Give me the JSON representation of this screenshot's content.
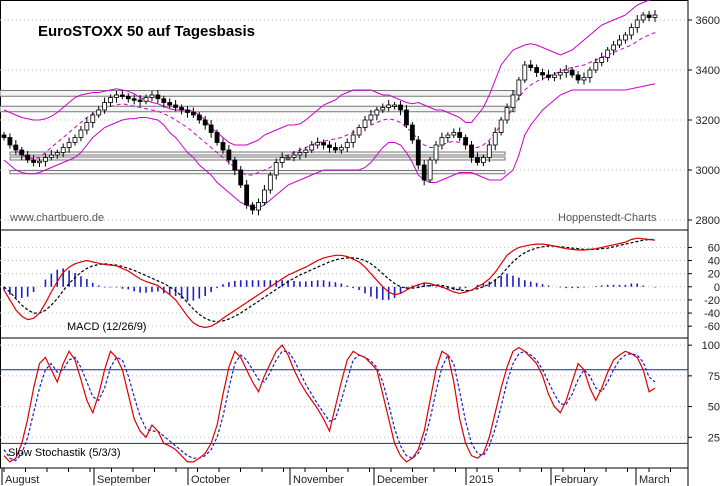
{
  "chart_data": [
    {
      "type": "candlestick",
      "title": "EuroSTOXX 50 auf Tagesbasis",
      "watermark_left": "www.chartbuero.de",
      "watermark_right": "Hoppenstedt-Charts",
      "y_ticks": [
        "2800",
        "3000",
        "3200",
        "3400",
        "3600"
      ],
      "ylim": [
        2760,
        3680
      ],
      "x_months": [
        "August",
        "September",
        "October",
        "November",
        "December",
        "2015",
        "February",
        "March"
      ],
      "resistance_boxes": [
        [
          3295,
          3318
        ],
        [
          3233,
          3255
        ],
        [
          3060,
          3072
        ],
        [
          3040,
          3052
        ],
        [
          2985,
          2998
        ]
      ],
      "series": [
        {
          "role": "price",
          "values": [
            3130,
            3100,
            3080,
            3060,
            3040,
            3030,
            3035,
            3050,
            3060,
            3070,
            3090,
            3110,
            3130,
            3160,
            3190,
            3220,
            3240,
            3270,
            3290,
            3300,
            3295,
            3285,
            3280,
            3275,
            3290,
            3300,
            3285,
            3270,
            3260,
            3250,
            3240,
            3230,
            3220,
            3200,
            3180,
            3150,
            3110,
            3080,
            3040,
            3000,
            2940,
            2860,
            2840,
            2870,
            2920,
            2980,
            3030,
            3050,
            3050,
            3060,
            3070,
            3080,
            3100,
            3110,
            3100,
            3090,
            3080,
            3090,
            3110,
            3140,
            3170,
            3200,
            3220,
            3240,
            3250,
            3260,
            3260,
            3240,
            3180,
            3120,
            3020,
            2960,
            3040,
            3100,
            3130,
            3140,
            3150,
            3130,
            3100,
            3050,
            3030,
            3050,
            3100,
            3150,
            3200,
            3250,
            3300,
            3360,
            3420,
            3410,
            3390,
            3380,
            3370,
            3380,
            3390,
            3400,
            3380,
            3360,
            3370,
            3400,
            3430,
            3450,
            3480,
            3500,
            3520,
            3540,
            3570,
            3600,
            3620,
            3610,
            3620
          ]
        },
        {
          "role": "bollinger-mid",
          "values": [
            3140,
            3110,
            3080,
            3060,
            3050,
            3045,
            3050,
            3070,
            3090,
            3110,
            3130,
            3150,
            3170,
            3190,
            3210,
            3225,
            3235,
            3245,
            3255,
            3260,
            3265,
            3260,
            3255,
            3250,
            3245,
            3240,
            3235,
            3225,
            3215,
            3200,
            3185,
            3170,
            3150,
            3130,
            3110,
            3090,
            3070,
            3050,
            3030,
            3010,
            2990,
            2980,
            2980,
            2990,
            3000,
            3010,
            3030,
            3050,
            3060,
            3070,
            3080,
            3090,
            3100,
            3110,
            3115,
            3120,
            3125,
            3130,
            3140,
            3150,
            3160,
            3170,
            3180,
            3190,
            3200,
            3205,
            3200,
            3190,
            3170,
            3150,
            3120,
            3100,
            3090,
            3090,
            3100,
            3110,
            3115,
            3110,
            3100,
            3090,
            3090,
            3100,
            3120,
            3150,
            3180,
            3210,
            3250,
            3290,
            3320,
            3340,
            3355,
            3365,
            3375,
            3385,
            3395,
            3405,
            3410,
            3415,
            3420,
            3430,
            3440,
            3450,
            3460,
            3470,
            3480,
            3490,
            3500,
            3515,
            3530,
            3540,
            3550
          ]
        },
        {
          "role": "bollinger-upper",
          "values": [
            3240,
            3230,
            3220,
            3210,
            3205,
            3200,
            3200,
            3205,
            3215,
            3230,
            3250,
            3270,
            3290,
            3300,
            3305,
            3310,
            3310,
            3315,
            3320,
            3325,
            3320,
            3315,
            3305,
            3290,
            3280,
            3270,
            3265,
            3255,
            3245,
            3240,
            3240,
            3240,
            3235,
            3220,
            3200,
            3170,
            3150,
            3130,
            3110,
            3100,
            3100,
            3100,
            3110,
            3120,
            3140,
            3150,
            3160,
            3170,
            3180,
            3180,
            3185,
            3200,
            3220,
            3240,
            3260,
            3270,
            3280,
            3300,
            3310,
            3320,
            3320,
            3320,
            3320,
            3310,
            3300,
            3300,
            3290,
            3280,
            3270,
            3265,
            3270,
            3260,
            3250,
            3240,
            3240,
            3230,
            3220,
            3210,
            3190,
            3190,
            3220,
            3250,
            3300,
            3360,
            3420,
            3450,
            3480,
            3490,
            3500,
            3505,
            3500,
            3490,
            3480,
            3470,
            3460,
            3470,
            3480,
            3500,
            3520,
            3540,
            3560,
            3580,
            3590,
            3600,
            3610,
            3620,
            3640,
            3660,
            3670,
            3680,
            3690
          ]
        },
        {
          "role": "bollinger-lower",
          "values": [
            3040,
            3020,
            3000,
            2990,
            2985,
            2985,
            2990,
            3000,
            3010,
            3020,
            3030,
            3040,
            3050,
            3070,
            3100,
            3130,
            3150,
            3170,
            3180,
            3190,
            3200,
            3205,
            3205,
            3210,
            3210,
            3205,
            3200,
            3180,
            3150,
            3130,
            3100,
            3070,
            3050,
            3020,
            3000,
            2980,
            2950,
            2930,
            2910,
            2890,
            2870,
            2860,
            2850,
            2850,
            2860,
            2880,
            2900,
            2920,
            2940,
            2950,
            2960,
            2970,
            2980,
            2990,
            3000,
            3000,
            3000,
            3000,
            3000,
            3000,
            3000,
            3010,
            3030,
            3060,
            3090,
            3110,
            3110,
            3100,
            3070,
            3030,
            2980,
            2960,
            2950,
            2950,
            2960,
            2970,
            2980,
            2990,
            2990,
            2990,
            2980,
            2970,
            2960,
            2960,
            2960,
            2980,
            3000,
            3060,
            3140,
            3180,
            3210,
            3240,
            3260,
            3280,
            3300,
            3310,
            3320,
            3320,
            3320,
            3320,
            3320,
            3320,
            3320,
            3320,
            3320,
            3320,
            3325,
            3330,
            3335,
            3340,
            3345
          ]
        }
      ]
    },
    {
      "type": "line",
      "label": "MACD (12/26/9)",
      "y_ticks": [
        "60",
        "40",
        "20",
        "0",
        "-20",
        "-40",
        "-60"
      ],
      "ylim": [
        -78,
        85
      ],
      "series": [
        {
          "role": "macd",
          "values": [
            -5,
            -20,
            -35,
            -45,
            -50,
            -48,
            -40,
            -25,
            -8,
            8,
            22,
            30,
            35,
            38,
            40,
            38,
            36,
            34,
            33,
            32,
            28,
            24,
            18,
            12,
            8,
            5,
            2,
            -5,
            -12,
            -20,
            -32,
            -45,
            -55,
            -60,
            -62,
            -60,
            -55,
            -48,
            -42,
            -36,
            -30,
            -24,
            -18,
            -12,
            -6,
            0,
            6,
            12,
            18,
            22,
            26,
            30,
            35,
            40,
            44,
            46,
            48,
            48,
            46,
            42,
            38,
            30,
            20,
            10,
            0,
            -8,
            -12,
            -10,
            -5,
            0,
            3,
            6,
            5,
            2,
            0,
            -4,
            -8,
            -10,
            -8,
            -5,
            0,
            5,
            12,
            22,
            35,
            48,
            55,
            60,
            62,
            64,
            65,
            65,
            64,
            62,
            60,
            58,
            57,
            56,
            56,
            57,
            58,
            60,
            62,
            64,
            66,
            68,
            72,
            74,
            73,
            72,
            71
          ]
        },
        {
          "role": "signal",
          "values": [
            0,
            -8,
            -18,
            -28,
            -35,
            -40,
            -40,
            -36,
            -28,
            -18,
            -6,
            5,
            14,
            22,
            28,
            32,
            34,
            35,
            34,
            33,
            31,
            28,
            25,
            21,
            17,
            13,
            9,
            5,
            0,
            -6,
            -14,
            -24,
            -34,
            -42,
            -48,
            -52,
            -53,
            -52,
            -49,
            -45,
            -40,
            -34,
            -28,
            -22,
            -16,
            -10,
            -4,
            2,
            8,
            13,
            18,
            22,
            26,
            30,
            34,
            38,
            41,
            43,
            44,
            44,
            43,
            40,
            35,
            28,
            20,
            12,
            5,
            0,
            -2,
            -2,
            -1,
            1,
            2,
            3,
            2,
            0,
            -3,
            -5,
            -6,
            -5,
            -3,
            0,
            4,
            10,
            18,
            28,
            38,
            46,
            52,
            56,
            59,
            61,
            62,
            62,
            61,
            60,
            59,
            58,
            57,
            57,
            57,
            58,
            59,
            61,
            63,
            65,
            67,
            69,
            71,
            72,
            72
          ]
        }
      ]
    },
    {
      "type": "line",
      "label": "Slow Stochastik (5/3/3)",
      "y_ticks": [
        "100",
        "75",
        "50",
        "25"
      ],
      "ylim": [
        0,
        105
      ],
      "levels": [
        80,
        20
      ],
      "series": [
        {
          "role": "k",
          "values": [
            10,
            5,
            8,
            20,
            40,
            65,
            85,
            90,
            80,
            70,
            85,
            95,
            88,
            72,
            55,
            45,
            60,
            80,
            95,
            90,
            80,
            60,
            40,
            30,
            25,
            35,
            30,
            20,
            18,
            15,
            10,
            5,
            5,
            8,
            12,
            20,
            35,
            60,
            82,
            95,
            90,
            80,
            70,
            62,
            75,
            85,
            95,
            100,
            92,
            80,
            70,
            62,
            55,
            48,
            40,
            30,
            50,
            70,
            88,
            95,
            92,
            90,
            85,
            80,
            60,
            40,
            20,
            10,
            5,
            8,
            15,
            30,
            55,
            80,
            95,
            92,
            70,
            40,
            20,
            10,
            8,
            12,
            25,
            45,
            65,
            82,
            95,
            98,
            95,
            90,
            85,
            75,
            60,
            50,
            45,
            55,
            70,
            85,
            80,
            65,
            55,
            65,
            78,
            88,
            92,
            95,
            93,
            90,
            80,
            62,
            65
          ]
        },
        {
          "role": "d",
          "values": [
            15,
            8,
            6,
            12,
            25,
            45,
            65,
            80,
            85,
            78,
            80,
            88,
            90,
            82,
            70,
            58,
            55,
            65,
            82,
            90,
            88,
            75,
            58,
            42,
            32,
            30,
            30,
            26,
            22,
            18,
            14,
            10,
            8,
            8,
            10,
            15,
            25,
            42,
            65,
            85,
            92,
            88,
            80,
            72,
            70,
            78,
            88,
            95,
            95,
            88,
            78,
            68,
            60,
            52,
            45,
            38,
            40,
            55,
            72,
            88,
            92,
            90,
            87,
            82,
            70,
            52,
            32,
            18,
            10,
            8,
            12,
            22,
            40,
            62,
            82,
            92,
            85,
            62,
            38,
            20,
            12,
            10,
            18,
            32,
            50,
            70,
            85,
            93,
            95,
            92,
            88,
            80,
            70,
            60,
            52,
            52,
            60,
            72,
            80,
            75,
            65,
            62,
            70,
            80,
            88,
            92,
            93,
            92,
            86,
            74,
            70
          ]
        }
      ]
    }
  ]
}
